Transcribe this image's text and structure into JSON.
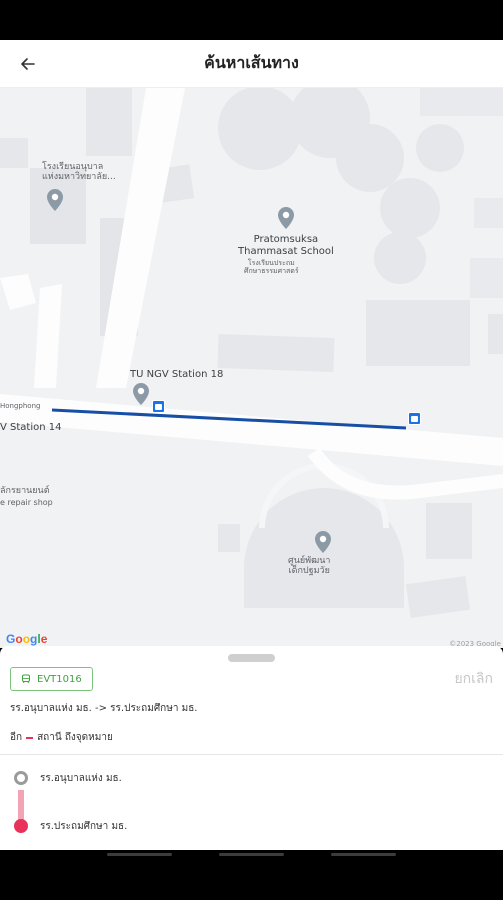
{
  "header": {
    "title": "ค้นหาเส้นทาง"
  },
  "map": {
    "labels": {
      "school_left": "โรงเรียนอนุบาล\nแห่งมหาวิทยาลัย...",
      "school_main_en": "Pratomsuksa\nThammasat School",
      "school_main_th": "โรงเรียนประถม\nศึกษาธรรมศาสตร์",
      "station": "TU NGV Station 18",
      "station_road": "V Station 14",
      "road_left": "Hongphong",
      "repair_th": "ลักรยานยนต์",
      "repair_en": "e repair shop",
      "center": "ศูนย์พัฒนา\nเด็กปฐมวัย"
    },
    "google": "Google",
    "copyright": "©2023 Google"
  },
  "sheet": {
    "vehicle": "EVT1016",
    "cancel": "ยกเลิก",
    "route": "รร.อนุบาลแห่ง มธ. -> รร.ประถมศึกษา มธ.",
    "eta_prefix": "อีก",
    "eta_suffix": "สถานี ถึงจุดหมาย",
    "origin": "รร.อนุบาลแห่ง มธ.",
    "destination": "รร.ประถมศึกษา มธ."
  },
  "colors": {
    "route_line": "#174ea6",
    "accent_pink": "#e8325a",
    "chip_green": "#3fa33f"
  }
}
